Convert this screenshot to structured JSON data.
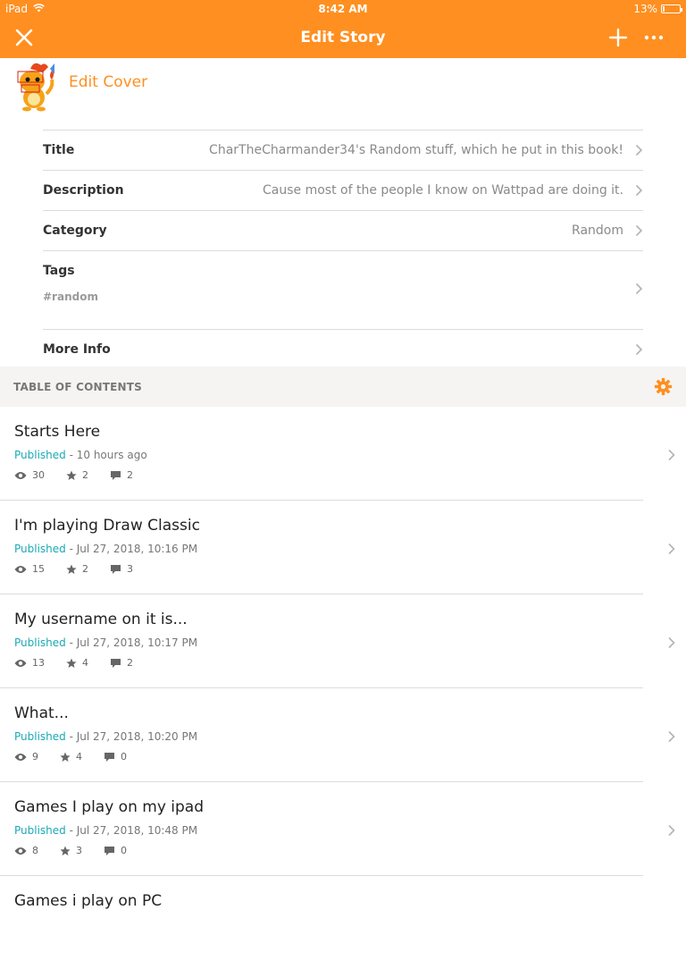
{
  "status_bar": {
    "device": "iPad",
    "time": "8:42 AM",
    "battery": "13%",
    "battery_level": 0.13
  },
  "nav": {
    "title": "Edit Story",
    "close_icon": "close-icon",
    "add_icon": "plus-icon",
    "more_icon": "more-icon"
  },
  "cover": {
    "label": "Edit Cover"
  },
  "fields": {
    "title": {
      "label": "Title",
      "value": "CharTheCharmander34's Random stuff, which he put in this book!"
    },
    "description": {
      "label": "Description",
      "value": "Cause most of the people I know on Wattpad are doing it."
    },
    "category": {
      "label": "Category",
      "value": "Random"
    },
    "tags": {
      "label": "Tags",
      "value": "#random"
    },
    "more_info": {
      "label": "More Info"
    }
  },
  "toc": {
    "header": "TABLE OF CONTENTS"
  },
  "parts": [
    {
      "title": "Starts Here",
      "status": "Published",
      "date": " - 10 hours ago",
      "views": "30",
      "votes": "2",
      "comments": "2"
    },
    {
      "title": "I'm playing Draw Classic",
      "status": "Published",
      "date": " - Jul 27, 2018, 10:16 PM",
      "views": "15",
      "votes": "2",
      "comments": "3"
    },
    {
      "title": "My username on it is...",
      "status": "Published",
      "date": " - Jul 27, 2018, 10:17 PM",
      "views": "13",
      "votes": "4",
      "comments": "2"
    },
    {
      "title": "What...",
      "status": "Published",
      "date": " - Jul 27, 2018, 10:20 PM",
      "views": "9",
      "votes": "4",
      "comments": "0"
    },
    {
      "title": "Games I play on my ipad",
      "status": "Published",
      "date": " - Jul 27, 2018, 10:48 PM",
      "views": "8",
      "votes": "3",
      "comments": "0"
    },
    {
      "title": "Games i play on PC",
      "status": "",
      "date": "",
      "views": "",
      "votes": "",
      "comments": ""
    }
  ],
  "colors": {
    "accent": "#ff8f20",
    "published": "#1aa9b5"
  }
}
